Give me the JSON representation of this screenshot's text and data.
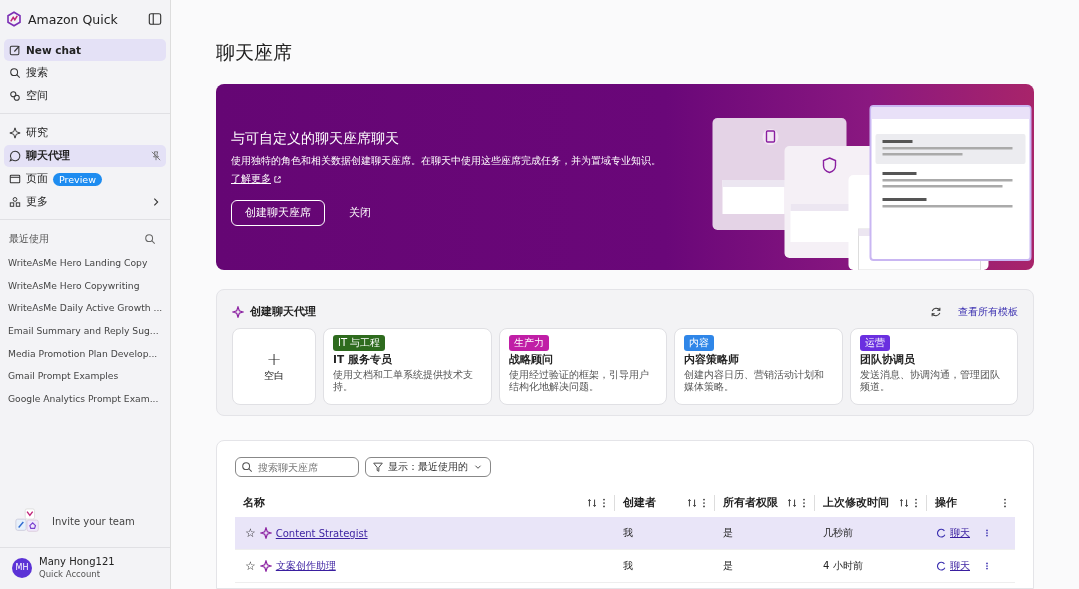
{
  "sidebar": {
    "brand": "Amazon Quick",
    "nav": [
      {
        "label": "New chat",
        "selected": true
      },
      {
        "label": "搜索",
        "selected": false
      },
      {
        "label": "空间",
        "selected": false
      }
    ],
    "nav2": [
      {
        "label": "研究",
        "selected": false
      },
      {
        "label": "聊天代理",
        "selected": true,
        "pin": true
      },
      {
        "label": "页面",
        "selected": false,
        "badge": "Preview"
      },
      {
        "label": "更多",
        "selected": false,
        "chevron": true
      }
    ],
    "recent_title": "最近使用",
    "recent": [
      "WriteAsMe Hero Landing Copy",
      "WriteAsMe Hero Copywriting",
      "WriteAsMe Daily Active Growth ...",
      "Email Summary and Reply Sug...",
      "Media Promotion Plan Develop...",
      "Gmail Prompt Examples",
      "Google Analytics Prompt Exam..."
    ],
    "invite": "Invite your team",
    "user": {
      "initials": "MH",
      "name": "Many Hong121",
      "account": "Quick Account"
    }
  },
  "page_title": "聊天座席",
  "banner": {
    "title": "与可自定义的聊天座席聊天",
    "text": "使用独特的角色和相关数据创建聊天座席。在聊天中使用这些座席完成任务，并为置域专业知识。",
    "link": "了解更多",
    "primary": "创建聊天座席",
    "secondary": "关闭"
  },
  "create": {
    "title": "创建聊天代理",
    "view_all": "查看所有模板",
    "blank": "空白",
    "plus": "+",
    "templates": [
      {
        "tag": "IT 与工程",
        "color": "#2e6b1e",
        "name": "IT 服务专员",
        "desc": "使用文档和工单系统提供技术支持。"
      },
      {
        "tag": "生产力",
        "color": "#c01ea6",
        "name": "战略顾问",
        "desc": "使用经过验证的框架，引导用户结构化地解决问题。"
      },
      {
        "tag": "内容",
        "color": "#2f86e8",
        "name": "内容策略师",
        "desc": "创建内容日历、营销活动计划和媒体策略。"
      },
      {
        "tag": "运营",
        "color": "#6a2fe0",
        "name": "团队协调员",
        "desc": "发送消息、协调沟通，管理团队频道。"
      }
    ]
  },
  "table": {
    "search": {
      "placeholder": "搜索聊天座席"
    },
    "filter": "显示：最近使用的",
    "columns": [
      "名称",
      "创建者",
      "所有者权限",
      "上次修改时间",
      "操作"
    ],
    "rows": [
      {
        "star": "☆",
        "name": "Content Strategist",
        "creator": "我",
        "owner": "是",
        "modified": "几秒前",
        "action": "聊天",
        "selected": true
      },
      {
        "star": "☆",
        "name": "文案创作助理",
        "creator": "我",
        "owner": "是",
        "modified": "4 小时前",
        "action": "聊天",
        "selected": false
      }
    ]
  }
}
